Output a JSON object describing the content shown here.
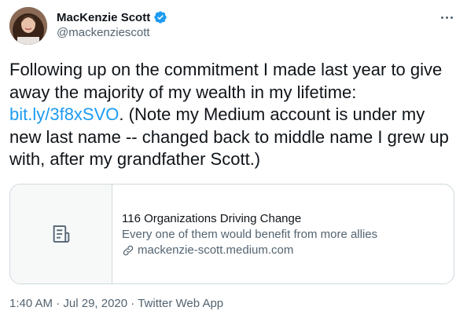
{
  "author": {
    "display_name": "MacKenzie Scott",
    "handle": "@mackenziescott",
    "verified": true
  },
  "tweet": {
    "text_before": "Following up on the commitment I made last year to give away the majority of my wealth in my lifetime: ",
    "link": "bit.ly/3f8xSVO",
    "text_after": ". (Note my Medium account is under my new last name -- changed back to middle name I grew up with, after my grandfather Scott.)"
  },
  "card": {
    "title": "116 Organizations Driving Change",
    "description": "Every one of them would benefit from more allies",
    "domain": "mackenzie-scott.medium.com",
    "thumb_icon": "document-icon"
  },
  "meta": {
    "time": "1:40 AM",
    "date": "Jul 29, 2020",
    "source": "Twitter Web App",
    "separator": "·"
  },
  "colors": {
    "link": "#1d9bf0",
    "verified": "#1d9bf0",
    "secondary_text": "#536471"
  }
}
